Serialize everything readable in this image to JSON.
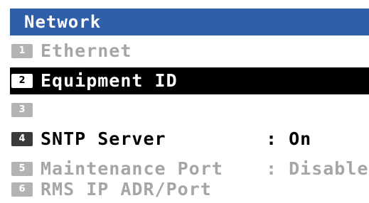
{
  "menu": {
    "title": "Network",
    "items": [
      {
        "number": "1",
        "label": "Ethernet",
        "value": "",
        "state": "disabled"
      },
      {
        "number": "2",
        "label": "Equipment ID",
        "value": "",
        "state": "selected"
      },
      {
        "number": "3",
        "label": "",
        "value": "",
        "state": "disabled"
      },
      {
        "number": "4",
        "label": "SNTP Server",
        "value": ": On",
        "state": "enabled"
      },
      {
        "number": "5",
        "label": "Maintenance Port",
        "value": ": Disable",
        "state": "disabled"
      },
      {
        "number": "6",
        "label": "RMS IP ADR/Port",
        "value": "",
        "state": "disabled"
      }
    ]
  },
  "colors": {
    "header_background": "#2f5fa8",
    "header_text": "#ffffff",
    "selected_background": "#000000",
    "selected_text": "#ffffff",
    "enabled_text": "#000000",
    "disabled_text": "#a6a6a6",
    "disabled_number_badge": "#b3b3b3",
    "enabled_number_badge": "#3a3a3a"
  }
}
